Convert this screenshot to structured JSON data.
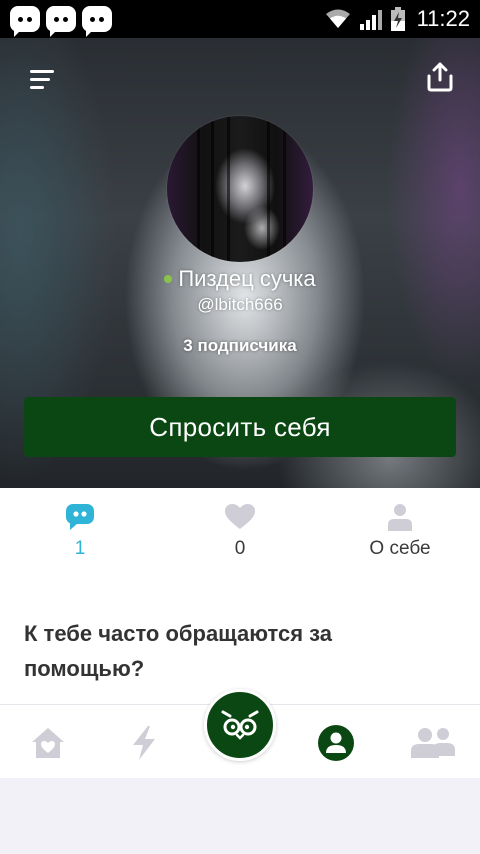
{
  "status_bar": {
    "time": "11:22",
    "notification_icons": [
      "chat-bubble-icon",
      "chat-bubble-icon",
      "chat-bubble-icon"
    ],
    "system_icons": [
      "wifi-icon",
      "signal-icon",
      "battery-charging-icon"
    ]
  },
  "header": {
    "menu_icon": "menu-icon",
    "share_icon": "share-icon"
  },
  "profile": {
    "name": "Пиздец сучка",
    "handle": "@lbitch666",
    "followers": "3 подписчика",
    "online": true,
    "ask_button_label": "Спросить себя"
  },
  "tabs": [
    {
      "icon": "answers-bubble-icon",
      "label": "1",
      "active": true
    },
    {
      "icon": "heart-icon",
      "label": "0",
      "active": false
    },
    {
      "icon": "person-icon",
      "label": "О себе",
      "active": false
    }
  ],
  "question": {
    "text": "К тебе часто обращаются за помощью?"
  },
  "bottom_nav": [
    {
      "icon": "home-icon"
    },
    {
      "icon": "lightning-icon"
    },
    {
      "icon": "owl-icon"
    },
    {
      "icon": "profile-icon",
      "active": true
    },
    {
      "icon": "friends-icon"
    }
  ],
  "colors": {
    "brand_green": "#0a4712",
    "accent_blue": "#2fb3d6",
    "online_green": "#8bc34a",
    "inactive_icon": "#cfcdd6"
  }
}
